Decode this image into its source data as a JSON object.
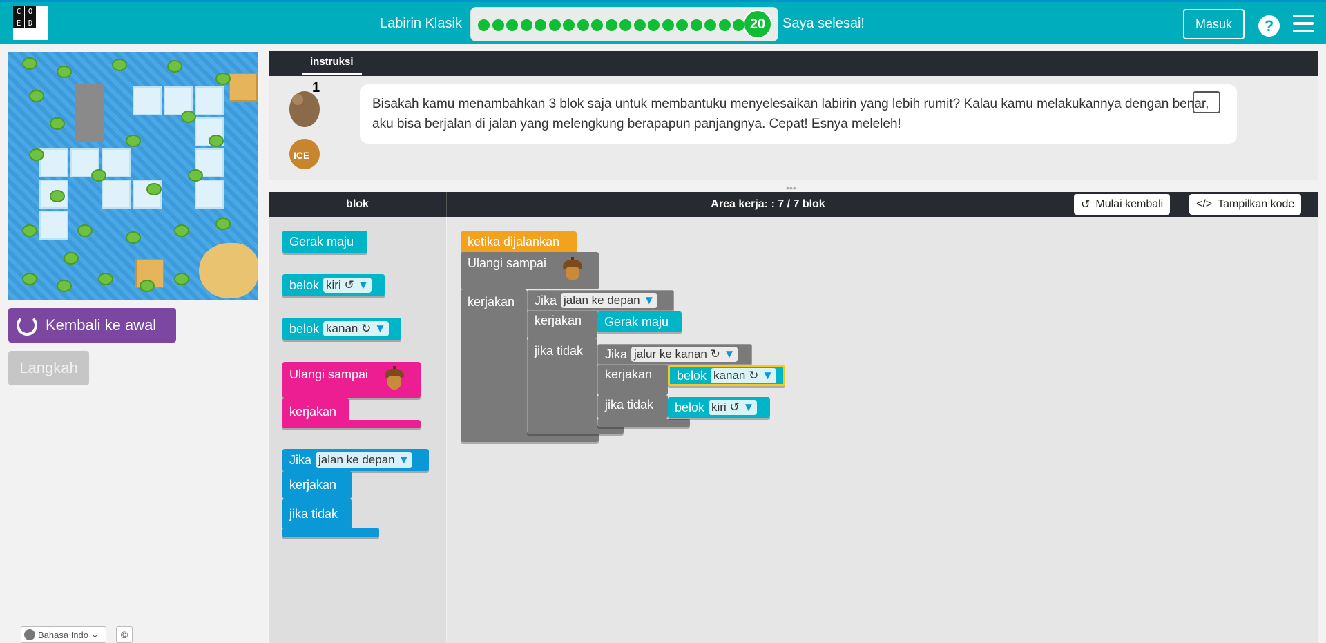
{
  "header": {
    "logo_letters": [
      "C",
      "O",
      "D",
      "E"
    ],
    "level_title": "Labirin Klasik",
    "current_level": "20",
    "finish": "Saya selesai!",
    "signin": "Masuk",
    "help": "?"
  },
  "left": {
    "reset_button": "Kembali ke awal",
    "step_button": "Langkah",
    "language": "Bahasa Indo",
    "copyright": "©"
  },
  "instructions": {
    "tab": "instruksi",
    "hint_count": "1",
    "text": "Bisakah kamu menambahkan 3 blok saja untuk membantuku menyelesaikan labirin yang lebih rumit? Kalau kamu melakukannya dengan benar, aku bisa berjalan di jalan yang melengkung berapapun panjangnya. Cepat! Esnya meleleh!"
  },
  "workspace_header": {
    "toolbox_title": "blok",
    "workspace_title": "Area kerja: : 7 / 7 blok",
    "restart": "Mulai kembali",
    "show_code": "Tampilkan kode"
  },
  "toolbox": {
    "move": "Gerak maju",
    "turn": "belok",
    "left": "kiri ↺",
    "right": "kanan ↻",
    "repeat": "Ulangi sampai",
    "do": "kerjakan",
    "if": "Jika",
    "path_ahead": "jalan ke depan",
    "else": "jika tidak"
  },
  "program": {
    "when_run": "ketika dijalankan",
    "repeat": "Ulangi sampai",
    "do": "kerjakan",
    "if": "Jika",
    "path_ahead": "jalan ke depan",
    "else": "jika tidak",
    "move": "Gerak maju",
    "path_right": "jalur ke kanan ↻",
    "turn": "belok",
    "right": "kanan ↻",
    "left": "kiri ↺"
  },
  "colors": {
    "header": "#00adbc",
    "progress_green": "#0fbe35",
    "reset_purple": "#7b47a0",
    "block_teal": "#00b5c8",
    "block_pink": "#ed1e91",
    "block_blue": "#0b98d6",
    "block_orange": "#f2a21c",
    "block_grey": "#7a7a7a"
  },
  "icons": [
    "globe-icon",
    "undo-icon",
    "code-icon",
    "speaker-icon",
    "menu-icon",
    "acorn-icon",
    "help-icon"
  ]
}
